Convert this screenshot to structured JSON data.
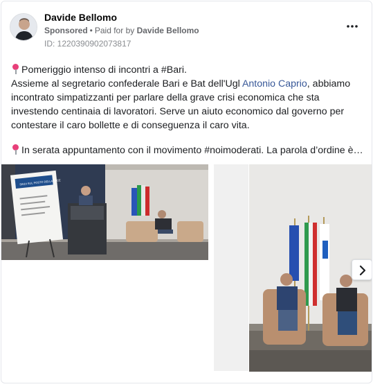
{
  "post": {
    "author": "Davide Bellomo",
    "sponsored_label": "Sponsored",
    "separator": "•",
    "paid_for_prefix": "Paid for by",
    "paid_for_name": "Davide Bellomo",
    "ad_id": "ID: 1220390902073817",
    "more_icon": "more-horizontal-icon",
    "text": {
      "line1": "Pomeriggio intenso di incontri a #Bari.",
      "para2_before_link": "Assieme al segretario confederale Bari e Bat dell'Ugl ",
      "para2_link": "Antonio Caprio",
      "para2_after_link": ", abbiamo incontrato simpatizzanti per parlare della grave crisi economica che sta investendo centinaia di lavoratori. Serve un aiuto economico dal governo per contestare il caro bollette e di conseguenza il caro vita.",
      "para3": "In serata appuntamento con il movimento #noimoderati. La parola d’ordine è…"
    },
    "colors": {
      "link": "#385898",
      "pin": "#e8407a",
      "meta": "#65676b"
    }
  },
  "carousel": {
    "next_icon": "chevron-right-icon",
    "poster_title": "SIEDI SUL POSTO DELLA PACE"
  }
}
